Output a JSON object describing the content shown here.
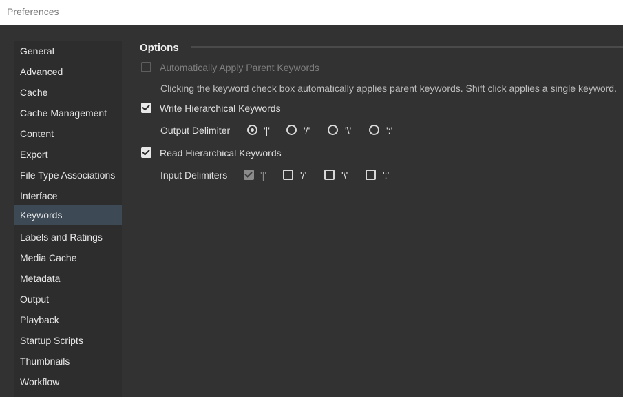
{
  "window": {
    "title": "Preferences"
  },
  "sidebar": {
    "items": [
      {
        "label": "General"
      },
      {
        "label": "Advanced"
      },
      {
        "label": "Cache"
      },
      {
        "label": "Cache Management"
      },
      {
        "label": "Content"
      },
      {
        "label": "Export"
      },
      {
        "label": "File Type Associations"
      },
      {
        "label": "Interface"
      },
      {
        "label": "Keywords",
        "selected": true
      },
      {
        "label": "Labels and Ratings"
      },
      {
        "label": "Media Cache"
      },
      {
        "label": "Metadata"
      },
      {
        "label": "Output"
      },
      {
        "label": "Playback"
      },
      {
        "label": "Startup Scripts"
      },
      {
        "label": "Thumbnails"
      },
      {
        "label": "Workflow"
      }
    ]
  },
  "options": {
    "title": "Options",
    "auto_apply_parent": {
      "label": "Automatically Apply Parent Keywords",
      "checked": false,
      "enabled": false
    },
    "description": "Clicking the keyword check box automatically applies parent keywords. Shift click applies a single keyword.",
    "write_hierarchical": {
      "label": "Write Hierarchical Keywords",
      "checked": true
    },
    "output_delimiter": {
      "label": "Output Delimiter",
      "options": [
        {
          "label": "'|'",
          "selected": true
        },
        {
          "label": "'/'",
          "selected": false
        },
        {
          "label": "'\\'",
          "selected": false
        },
        {
          "label": "':'",
          "selected": false
        }
      ]
    },
    "read_hierarchical": {
      "label": "Read Hierarchical Keywords",
      "checked": true
    },
    "input_delimiters": {
      "label": "Input Delimiters",
      "options": [
        {
          "label": "'|'",
          "checked": true,
          "enabled": false
        },
        {
          "label": "'/'",
          "checked": false,
          "enabled": true
        },
        {
          "label": "'\\'",
          "checked": false,
          "enabled": true
        },
        {
          "label": "':'",
          "checked": false,
          "enabled": true
        }
      ]
    }
  }
}
